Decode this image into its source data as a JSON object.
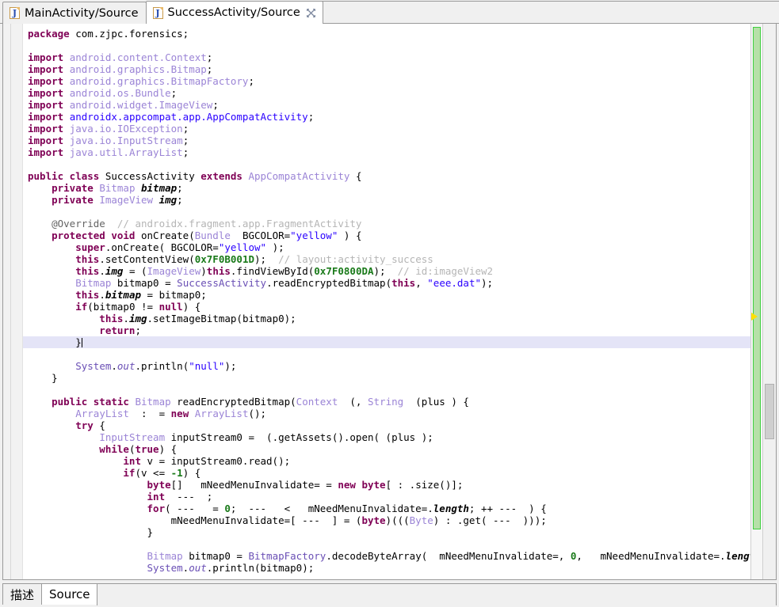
{
  "window": {
    "accent_green": "#3fcf3f",
    "marker_yellow": "#ffe000",
    "highlight_line_color": "#e4e4f7"
  },
  "tabs": {
    "items": [
      {
        "label": "MainActivity/Source",
        "icon": "java-file-icon",
        "icon_char": "J",
        "active": false,
        "closable": false
      },
      {
        "label": "SuccessActivity/Source",
        "icon": "java-file-icon",
        "icon_char": "J",
        "active": true,
        "closable": true
      }
    ]
  },
  "editor": {
    "scroll_percent": 72,
    "overview_marker_position_percent": 52,
    "caret_line_index": 26,
    "lines": [
      [
        {
          "t": "package ",
          "c": "kw"
        },
        {
          "t": "com.zjpc.forensics;",
          "c": ""
        }
      ],
      [],
      [
        {
          "t": "import ",
          "c": "kw"
        },
        {
          "t": "android.content.Context",
          "c": "typ"
        },
        {
          "t": ";",
          "c": ""
        }
      ],
      [
        {
          "t": "import ",
          "c": "kw"
        },
        {
          "t": "android.graphics.Bitmap",
          "c": "typ"
        },
        {
          "t": ";",
          "c": ""
        }
      ],
      [
        {
          "t": "import ",
          "c": "kw"
        },
        {
          "t": "android.graphics.BitmapFactory",
          "c": "typ"
        },
        {
          "t": ";",
          "c": ""
        }
      ],
      [
        {
          "t": "import ",
          "c": "kw"
        },
        {
          "t": "android.os.Bundle",
          "c": "typ"
        },
        {
          "t": ";",
          "c": ""
        }
      ],
      [
        {
          "t": "import ",
          "c": "kw"
        },
        {
          "t": "android.widget.ImageView",
          "c": "typ"
        },
        {
          "t": ";",
          "c": ""
        }
      ],
      [
        {
          "t": "import ",
          "c": "kw"
        },
        {
          "t": "androidx.appcompat.app.AppCompatActivity",
          "c": "str"
        },
        {
          "t": ";",
          "c": ""
        }
      ],
      [
        {
          "t": "import ",
          "c": "kw"
        },
        {
          "t": "java.io.IOException",
          "c": "typ"
        },
        {
          "t": ";",
          "c": ""
        }
      ],
      [
        {
          "t": "import ",
          "c": "kw"
        },
        {
          "t": "java.io.InputStream",
          "c": "typ"
        },
        {
          "t": ";",
          "c": ""
        }
      ],
      [
        {
          "t": "import ",
          "c": "kw"
        },
        {
          "t": "java.util.ArrayList",
          "c": "typ"
        },
        {
          "t": ";",
          "c": ""
        }
      ],
      [],
      [
        {
          "t": "public class ",
          "c": "kw"
        },
        {
          "t": "SuccessActivity ",
          "c": ""
        },
        {
          "t": "extends ",
          "c": "kw"
        },
        {
          "t": "AppCompatActivity",
          "c": "typ"
        },
        {
          "t": " {",
          "c": ""
        }
      ],
      [
        {
          "t": "    private ",
          "c": "kw"
        },
        {
          "t": "Bitmap ",
          "c": "typ"
        },
        {
          "t": "bitmap",
          "c": "fldb"
        },
        {
          "t": ";",
          "c": ""
        }
      ],
      [
        {
          "t": "    private ",
          "c": "kw"
        },
        {
          "t": "ImageView ",
          "c": "typ"
        },
        {
          "t": "img",
          "c": "fldb"
        },
        {
          "t": ";",
          "c": ""
        }
      ],
      [],
      [
        {
          "t": "    @Override",
          "c": "ann"
        },
        {
          "t": "  // androidx.fragment.app.FragmentActivity",
          "c": "cmt"
        }
      ],
      [
        {
          "t": "    protected void ",
          "c": "kw"
        },
        {
          "t": "onCreate(",
          "c": ""
        },
        {
          "t": "Bundle",
          "c": "typ"
        },
        {
          "t": "  BGCOLOR=",
          "c": ""
        },
        {
          "t": "\"yellow\"",
          "c": "str"
        },
        {
          "t": " ) {",
          "c": ""
        }
      ],
      [
        {
          "t": "        super",
          "c": "kw"
        },
        {
          "t": ".onCreate( BGCOLOR=",
          "c": ""
        },
        {
          "t": "\"yellow\"",
          "c": "str"
        },
        {
          "t": " );",
          "c": ""
        }
      ],
      [
        {
          "t": "        this",
          "c": "kw"
        },
        {
          "t": ".setContentView(",
          "c": ""
        },
        {
          "t": "0x7F0B001D",
          "c": "num"
        },
        {
          "t": ");",
          "c": ""
        },
        {
          "t": "  // layout:activity_success",
          "c": "cmt"
        }
      ],
      [
        {
          "t": "        this",
          "c": "kw"
        },
        {
          "t": ".",
          "c": ""
        },
        {
          "t": "img",
          "c": "fldb"
        },
        {
          "t": " = (",
          "c": ""
        },
        {
          "t": "ImageView",
          "c": "typ"
        },
        {
          "t": ")",
          "c": ""
        },
        {
          "t": "this",
          "c": "kw"
        },
        {
          "t": ".findViewById(",
          "c": ""
        },
        {
          "t": "0x7F0800DA",
          "c": "num"
        },
        {
          "t": ");",
          "c": ""
        },
        {
          "t": "  // id:imageView2",
          "c": "cmt"
        }
      ],
      [
        {
          "t": "        ",
          "c": ""
        },
        {
          "t": "Bitmap",
          "c": "typ"
        },
        {
          "t": " bitmap0 = ",
          "c": ""
        },
        {
          "t": "SuccessActivity",
          "c": "statn"
        },
        {
          "t": ".readEncryptedBitmap(",
          "c": ""
        },
        {
          "t": "this",
          "c": "kw"
        },
        {
          "t": ", ",
          "c": ""
        },
        {
          "t": "\"eee.dat\"",
          "c": "str"
        },
        {
          "t": ");",
          "c": ""
        }
      ],
      [
        {
          "t": "        this",
          "c": "kw"
        },
        {
          "t": ".",
          "c": ""
        },
        {
          "t": "bitmap",
          "c": "fldb"
        },
        {
          "t": " = bitmap0;",
          "c": ""
        }
      ],
      [
        {
          "t": "        if",
          "c": "kw"
        },
        {
          "t": "(bitmap0 != ",
          "c": ""
        },
        {
          "t": "null",
          "c": "kw"
        },
        {
          "t": ") {",
          "c": ""
        }
      ],
      [
        {
          "t": "            this",
          "c": "kw"
        },
        {
          "t": ".",
          "c": ""
        },
        {
          "t": "img",
          "c": "fldb"
        },
        {
          "t": ".setImageBitmap(bitmap0);",
          "c": ""
        }
      ],
      [
        {
          "t": "            return",
          "c": "kw"
        },
        {
          "t": ";",
          "c": ""
        }
      ],
      [
        {
          "t": "        }",
          "c": ""
        }
      ],
      [],
      [
        {
          "t": "        ",
          "c": ""
        },
        {
          "t": "System",
          "c": "statn"
        },
        {
          "t": ".",
          "c": ""
        },
        {
          "t": "out",
          "c": "stat"
        },
        {
          "t": ".println(",
          "c": ""
        },
        {
          "t": "\"null\"",
          "c": "str"
        },
        {
          "t": ");",
          "c": ""
        }
      ],
      [
        {
          "t": "    }",
          "c": ""
        }
      ],
      [],
      [
        {
          "t": "    public static ",
          "c": "kw"
        },
        {
          "t": "Bitmap",
          "c": "typ"
        },
        {
          "t": " readEncryptedBitmap(",
          "c": ""
        },
        {
          "t": "Context",
          "c": "typ"
        },
        {
          "t": "  (, ",
          "c": ""
        },
        {
          "t": "String",
          "c": "typ"
        },
        {
          "t": "  (plus ) {",
          "c": ""
        }
      ],
      [
        {
          "t": "        ",
          "c": ""
        },
        {
          "t": "ArrayList",
          "c": "typ"
        },
        {
          "t": "  :  = ",
          "c": ""
        },
        {
          "t": "new ",
          "c": "kw"
        },
        {
          "t": "ArrayList",
          "c": "typ"
        },
        {
          "t": "();",
          "c": ""
        }
      ],
      [
        {
          "t": "        try",
          "c": "kw"
        },
        {
          "t": " {",
          "c": ""
        }
      ],
      [
        {
          "t": "            ",
          "c": ""
        },
        {
          "t": "InputStream",
          "c": "typ"
        },
        {
          "t": " inputStream0 =  (.getAssets().open( (plus );",
          "c": ""
        }
      ],
      [
        {
          "t": "            while",
          "c": "kw"
        },
        {
          "t": "(",
          "c": ""
        },
        {
          "t": "true",
          "c": "kw"
        },
        {
          "t": ") {",
          "c": ""
        }
      ],
      [
        {
          "t": "                int ",
          "c": "kw"
        },
        {
          "t": "v = inputStream0.read();",
          "c": ""
        }
      ],
      [
        {
          "t": "                if",
          "c": "kw"
        },
        {
          "t": "(v <= ",
          "c": ""
        },
        {
          "t": "-1",
          "c": "num"
        },
        {
          "t": ") {",
          "c": ""
        }
      ],
      [
        {
          "t": "                    byte",
          "c": "kw"
        },
        {
          "t": "[]   mNeedMenuInvalidate= = ",
          "c": ""
        },
        {
          "t": "new byte",
          "c": "kw"
        },
        {
          "t": "[ : .size()];",
          "c": ""
        }
      ],
      [
        {
          "t": "                    int",
          "c": "kw"
        },
        {
          "t": "  ---  ;",
          "c": ""
        }
      ],
      [
        {
          "t": "                    for",
          "c": "kw"
        },
        {
          "t": "( ---   = ",
          "c": ""
        },
        {
          "t": "0",
          "c": "num"
        },
        {
          "t": ";  ---   <   mNeedMenuInvalidate=.",
          "c": ""
        },
        {
          "t": "length",
          "c": "fldb"
        },
        {
          "t": "; ++ ---  ) {",
          "c": ""
        }
      ],
      [
        {
          "t": "                        mNeedMenuInvalidate=[ ---  ] = (",
          "c": ""
        },
        {
          "t": "byte",
          "c": "kw"
        },
        {
          "t": ")(((",
          "c": ""
        },
        {
          "t": "Byte",
          "c": "typ"
        },
        {
          "t": ") : .get( ---  )));",
          "c": ""
        }
      ],
      [
        {
          "t": "                    }",
          "c": ""
        }
      ],
      [],
      [
        {
          "t": "                    ",
          "c": ""
        },
        {
          "t": "Bitmap",
          "c": "typ"
        },
        {
          "t": " bitmap0 = ",
          "c": ""
        },
        {
          "t": "BitmapFactory",
          "c": "statn"
        },
        {
          "t": ".decodeByteArray(  mNeedMenuInvalidate=, ",
          "c": ""
        },
        {
          "t": "0",
          "c": "num"
        },
        {
          "t": ",   mNeedMenuInvalidate=.",
          "c": ""
        },
        {
          "t": "length",
          "c": "fldb"
        },
        {
          "t": ");",
          "c": ""
        }
      ],
      [
        {
          "t": "                    ",
          "c": ""
        },
        {
          "t": "System",
          "c": "statn"
        },
        {
          "t": ".",
          "c": ""
        },
        {
          "t": "out",
          "c": "stat"
        },
        {
          "t": ".println(bitmap0);",
          "c": ""
        }
      ]
    ]
  },
  "bottom_tabs": {
    "items": [
      {
        "label": "描述",
        "active": false
      },
      {
        "label": "Source",
        "active": true
      }
    ]
  }
}
